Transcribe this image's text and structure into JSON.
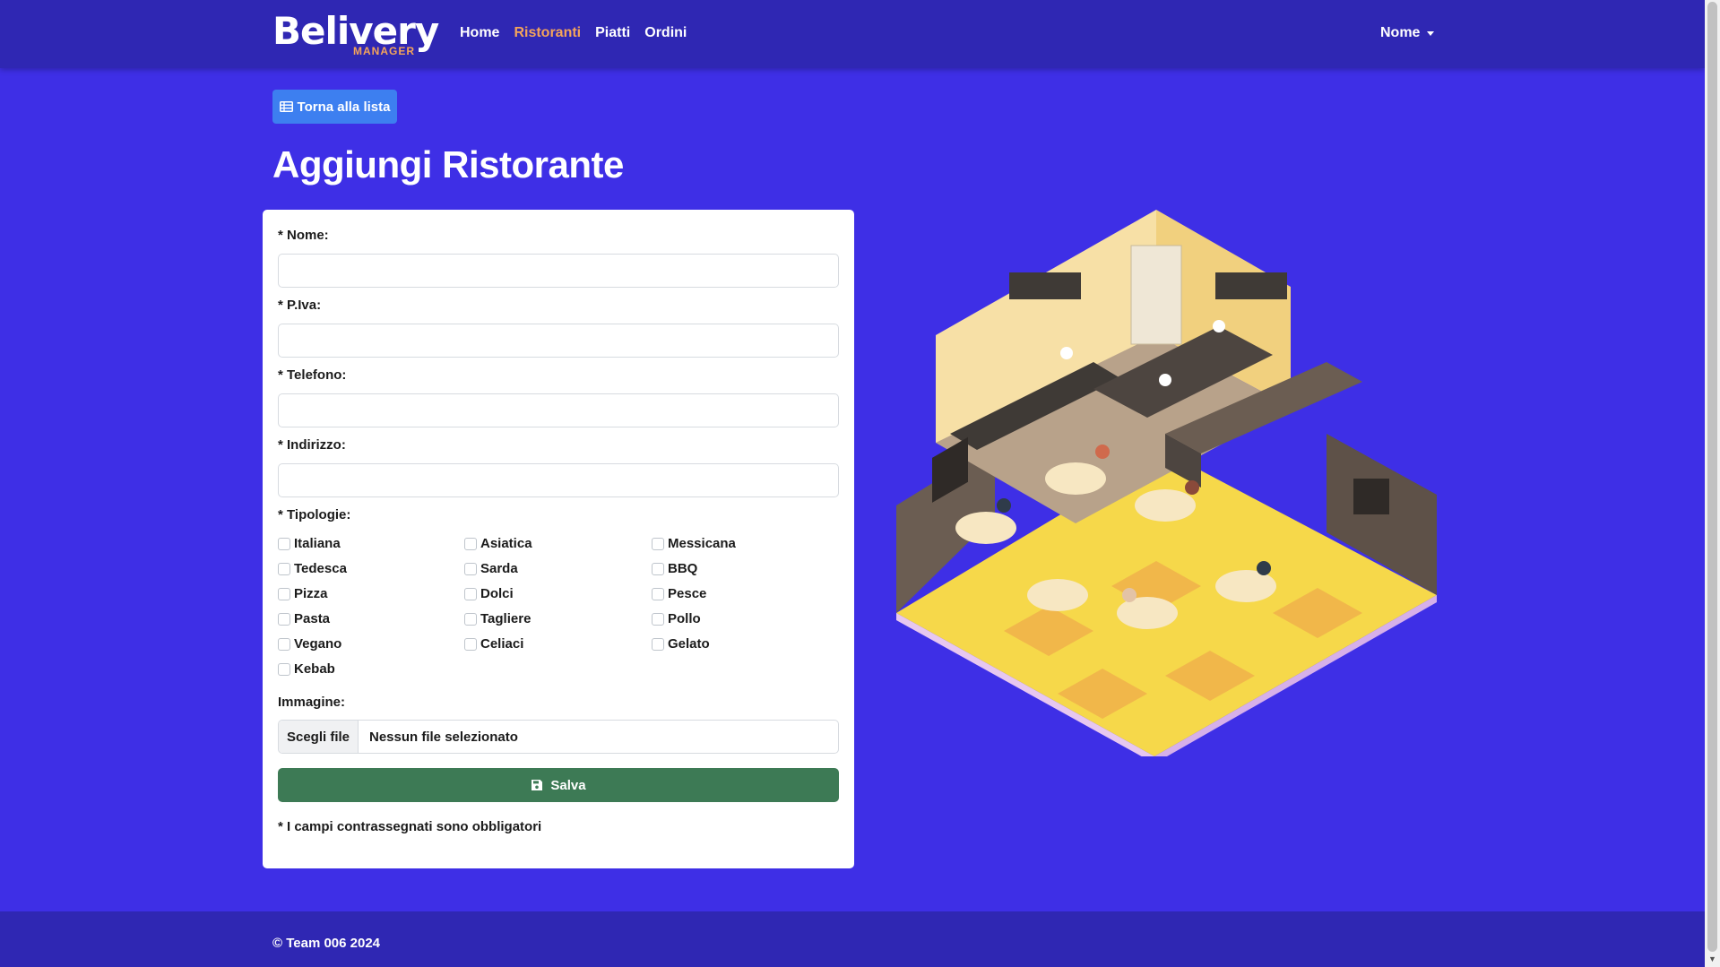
{
  "navbar": {
    "logo_main": "Belivery",
    "logo_sub": "MANAGER",
    "links": [
      {
        "label": "Home"
      },
      {
        "label": "Ristoranti"
      },
      {
        "label": "Piatti"
      },
      {
        "label": "Ordini"
      }
    ],
    "active_link": "Ristoranti",
    "user_menu_label": "Nome"
  },
  "back_button": {
    "label": "Torna alla lista",
    "icon": "table-icon"
  },
  "page_title": "Aggiungi Ristorante",
  "form": {
    "fields": [
      {
        "label": "* Nome:",
        "value": ""
      },
      {
        "label": "* P.Iva:",
        "value": ""
      },
      {
        "label": "* Telefono:",
        "value": ""
      },
      {
        "label": "* Indirizzo:",
        "value": ""
      }
    ],
    "types_label": "* Tipologie:",
    "types": [
      {
        "label": "Italiana",
        "checked": false
      },
      {
        "label": "Asiatica",
        "checked": false
      },
      {
        "label": "Messicana",
        "checked": false
      },
      {
        "label": "Tedesca",
        "checked": false
      },
      {
        "label": "Sarda",
        "checked": false
      },
      {
        "label": "BBQ",
        "checked": false
      },
      {
        "label": "Pizza",
        "checked": false
      },
      {
        "label": "Dolci",
        "checked": false
      },
      {
        "label": "Pesce",
        "checked": false
      },
      {
        "label": "Pasta",
        "checked": false
      },
      {
        "label": "Tagliere",
        "checked": false
      },
      {
        "label": "Pollo",
        "checked": false
      },
      {
        "label": "Vegano",
        "checked": false
      },
      {
        "label": "Celiaci",
        "checked": false
      },
      {
        "label": "Gelato",
        "checked": false
      },
      {
        "label": "Kebab",
        "checked": false
      }
    ],
    "image_label": "Immagine:",
    "file_button": "Scegli file",
    "file_status": "Nessun file selezionato",
    "save_label": "Salva",
    "save_icon": "floppy-disk-icon",
    "required_note": "* I campi contrassegnati sono obbligatori"
  },
  "illustration": {
    "alt": "isometric-restaurant-illustration"
  },
  "footer": {
    "text": "© Team 006 2024"
  },
  "colors": {
    "page_bg": "#3e2fe6",
    "navbar_bg": "#2f27b3",
    "active_link": "#f4a45a",
    "primary_button": "#3d7ff0",
    "save_button": "#3d7a55"
  }
}
